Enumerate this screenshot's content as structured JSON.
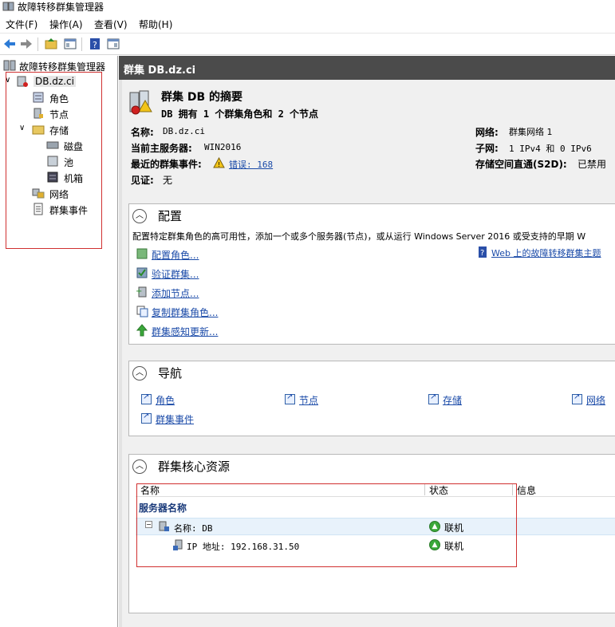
{
  "window": {
    "title": "故障转移群集管理器"
  },
  "menu": {
    "file": "文件(F)",
    "action": "操作(A)",
    "view": "查看(V)",
    "help": "帮助(H)"
  },
  "toolbar": {
    "back": "back-icon",
    "forward": "forward-icon",
    "up": "folder-up-icon",
    "showhide": "console-tree-icon",
    "help": "help-icon",
    "action_pane": "action-pane-icon"
  },
  "tree": {
    "root": "故障转移群集管理器",
    "cluster": "DB.dz.ci",
    "roles": "角色",
    "nodes": "节点",
    "storage": "存储",
    "disks": "磁盘",
    "pools": "池",
    "enclosures": "机箱",
    "networks": "网络",
    "events": "群集事件"
  },
  "header": {
    "title": "群集 DB.dz.ci"
  },
  "summary": {
    "title": "群集 DB 的摘要",
    "subtitle": "DB 拥有 1 个群集角色和 2 个节点",
    "name_label": "名称:",
    "name_value": "DB.dz.ci",
    "host_label": "当前主服务器:",
    "host_value": "WIN2016",
    "events_label": "最近的群集事件:",
    "events_value": "错误: 168",
    "witness_label": "见证:",
    "witness_value": "无",
    "network_label": "网络:",
    "network_value": "群集网络 1",
    "subnet_label": "子网:",
    "subnet_value": "1 IPv4 和 0 IPv6",
    "s2d_label": "存储空间直通(S2D):",
    "s2d_value": "已禁用"
  },
  "configure": {
    "title": "配置",
    "description": "配置特定群集角色的高可用性，添加一个或多个服务器(节点)，或从运行 Windows Server 2016 或受支持的早期 W",
    "links": [
      "配置角色...",
      "验证群集...",
      "添加节点...",
      "复制群集角色...",
      "群集感知更新..."
    ],
    "web_link": "Web 上的故障转移群集主题"
  },
  "navigate": {
    "title": "导航",
    "links": [
      "角色",
      "节点",
      "存储",
      "网络",
      "群集事件"
    ]
  },
  "core": {
    "title": "群集核心资源",
    "columns": [
      "名称",
      "状态",
      "信息"
    ],
    "group": "服务器名称",
    "rows": [
      {
        "name": "名称: DB",
        "status": "联机"
      },
      {
        "name": "IP 地址: 192.168.31.50",
        "status": "联机"
      }
    ]
  },
  "colors": {
    "header_bg": "#4b4b4b",
    "link": "#1a4aa8",
    "annotation": "#d03030",
    "online": "#3aa83a"
  }
}
